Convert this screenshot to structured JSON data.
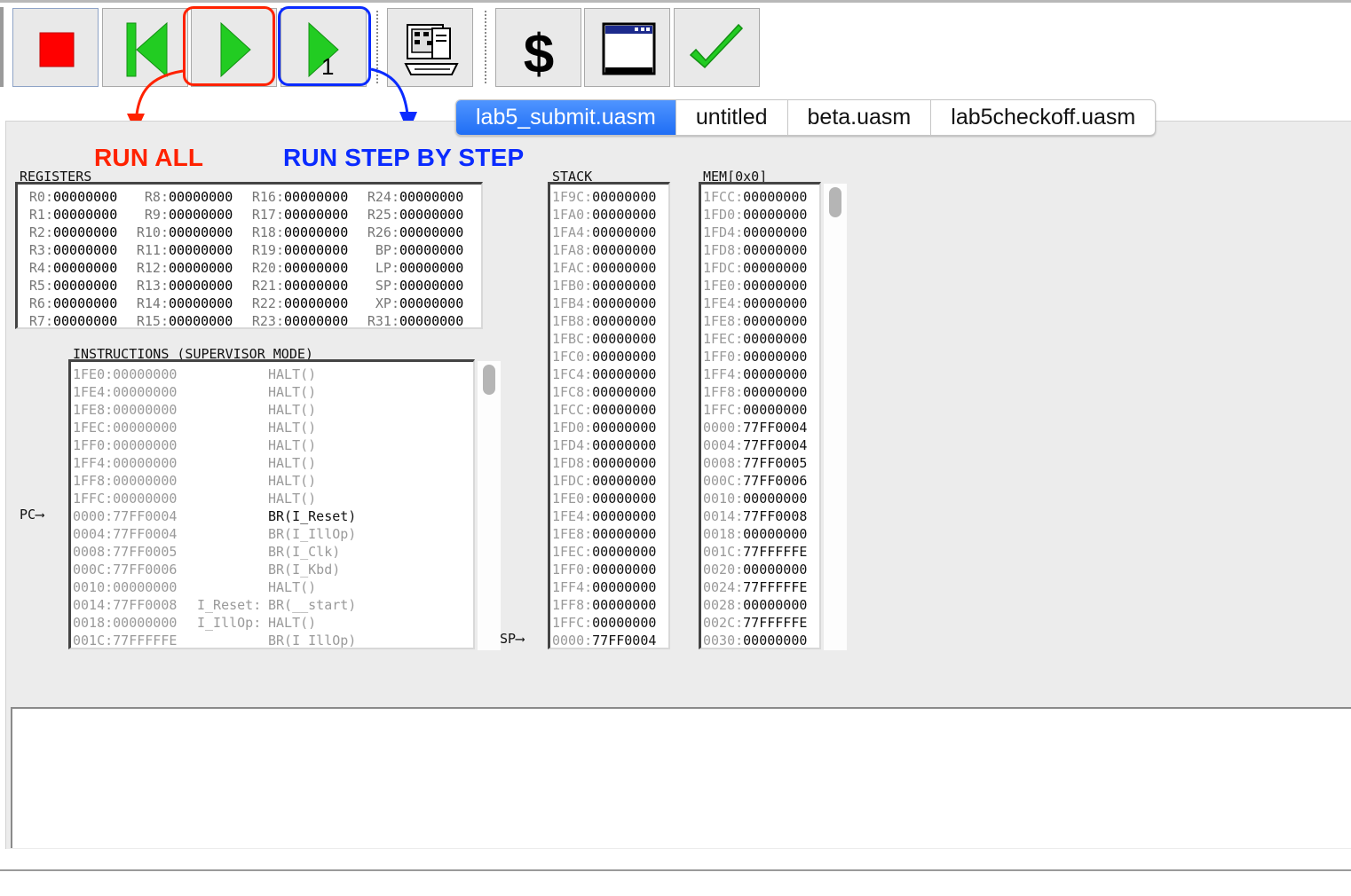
{
  "toolbar": {
    "buttons": [
      {
        "name": "stop-button",
        "icon": "stop-square-icon"
      },
      {
        "name": "reset-button",
        "icon": "skip-back-icon"
      },
      {
        "name": "run-button",
        "icon": "play-icon"
      },
      {
        "name": "step-button",
        "icon": "step-play-icon",
        "label": "1"
      },
      {
        "name": "assemble-button",
        "icon": "computer-icon"
      },
      {
        "name": "dollar-button",
        "icon": "dollar-icon"
      },
      {
        "name": "window-button",
        "icon": "window-icon"
      },
      {
        "name": "check-button",
        "icon": "checkmark-icon"
      }
    ],
    "step_count_label": "1"
  },
  "tabs": [
    {
      "label": "lab5_submit.uasm",
      "active": true
    },
    {
      "label": "untitled",
      "active": false
    },
    {
      "label": "beta.uasm",
      "active": false
    },
    {
      "label": "lab5checkoff.uasm",
      "active": false
    }
  ],
  "annotations": {
    "run_all": {
      "label": "RUN ALL",
      "color": "#ff2200"
    },
    "run_step": {
      "label": "RUN STEP BY STEP",
      "color": "#0a2bff"
    }
  },
  "registers": {
    "title": "REGISTERS",
    "rows": [
      [
        {
          "n": "R0:",
          "v": "00000000"
        },
        {
          "n": "R8:",
          "v": "00000000"
        },
        {
          "n": "R16:",
          "v": "00000000"
        },
        {
          "n": "R24:",
          "v": "00000000"
        }
      ],
      [
        {
          "n": "R1:",
          "v": "00000000"
        },
        {
          "n": "R9:",
          "v": "00000000"
        },
        {
          "n": "R17:",
          "v": "00000000"
        },
        {
          "n": "R25:",
          "v": "00000000"
        }
      ],
      [
        {
          "n": "R2:",
          "v": "00000000"
        },
        {
          "n": "R10:",
          "v": "00000000"
        },
        {
          "n": "R18:",
          "v": "00000000"
        },
        {
          "n": "R26:",
          "v": "00000000"
        }
      ],
      [
        {
          "n": "R3:",
          "v": "00000000"
        },
        {
          "n": "R11:",
          "v": "00000000"
        },
        {
          "n": "R19:",
          "v": "00000000"
        },
        {
          "n": "BP:",
          "v": "00000000"
        }
      ],
      [
        {
          "n": "R4:",
          "v": "00000000"
        },
        {
          "n": "R12:",
          "v": "00000000"
        },
        {
          "n": "R20:",
          "v": "00000000"
        },
        {
          "n": "LP:",
          "v": "00000000"
        }
      ],
      [
        {
          "n": "R5:",
          "v": "00000000"
        },
        {
          "n": "R13:",
          "v": "00000000"
        },
        {
          "n": "R21:",
          "v": "00000000"
        },
        {
          "n": "SP:",
          "v": "00000000"
        }
      ],
      [
        {
          "n": "R6:",
          "v": "00000000"
        },
        {
          "n": "R14:",
          "v": "00000000"
        },
        {
          "n": "R22:",
          "v": "00000000"
        },
        {
          "n": "XP:",
          "v": "00000000"
        }
      ],
      [
        {
          "n": "R7:",
          "v": "00000000"
        },
        {
          "n": "R15:",
          "v": "00000000"
        },
        {
          "n": "R23:",
          "v": "00000000"
        },
        {
          "n": "R31:",
          "v": "00000000"
        }
      ]
    ]
  },
  "instructions": {
    "title": "INSTRUCTIONS (SUPERVISOR MODE)",
    "pc_label": "PC",
    "rows": [
      {
        "addr": "1FE0:00000000",
        "label": "",
        "op": "HALT()",
        "current": false
      },
      {
        "addr": "1FE4:00000000",
        "label": "",
        "op": "HALT()",
        "current": false
      },
      {
        "addr": "1FE8:00000000",
        "label": "",
        "op": "HALT()",
        "current": false
      },
      {
        "addr": "1FEC:00000000",
        "label": "",
        "op": "HALT()",
        "current": false
      },
      {
        "addr": "1FF0:00000000",
        "label": "",
        "op": "HALT()",
        "current": false
      },
      {
        "addr": "1FF4:00000000",
        "label": "",
        "op": "HALT()",
        "current": false
      },
      {
        "addr": "1FF8:00000000",
        "label": "",
        "op": "HALT()",
        "current": false
      },
      {
        "addr": "1FFC:00000000",
        "label": "",
        "op": "HALT()",
        "current": false
      },
      {
        "addr": "0000:77FF0004",
        "label": "",
        "op": "BR(I_Reset)",
        "current": true
      },
      {
        "addr": "0004:77FF0004",
        "label": "",
        "op": "BR(I_IllOp)",
        "current": false
      },
      {
        "addr": "0008:77FF0005",
        "label": "",
        "op": "BR(I_Clk)",
        "current": false
      },
      {
        "addr": "000C:77FF0006",
        "label": "",
        "op": "BR(I_Kbd)",
        "current": false
      },
      {
        "addr": "0010:00000000",
        "label": "",
        "op": "HALT()",
        "current": false
      },
      {
        "addr": "0014:77FF0008",
        "label": "I_Reset:",
        "op": "BR(__start)",
        "current": false
      },
      {
        "addr": "0018:00000000",
        "label": "I_IllOp:",
        "op": "HALT()",
        "current": false
      },
      {
        "addr": "001C:77FFFFFE",
        "label": "",
        "op": "BR(I_IllOp)",
        "current": false
      }
    ]
  },
  "stack": {
    "title": "STACK",
    "sp_label": "SP",
    "rows": [
      {
        "a": "1F9C:",
        "v": "00000000"
      },
      {
        "a": "1FA0:",
        "v": "00000000"
      },
      {
        "a": "1FA4:",
        "v": "00000000"
      },
      {
        "a": "1FA8:",
        "v": "00000000"
      },
      {
        "a": "1FAC:",
        "v": "00000000"
      },
      {
        "a": "1FB0:",
        "v": "00000000"
      },
      {
        "a": "1FB4:",
        "v": "00000000"
      },
      {
        "a": "1FB8:",
        "v": "00000000"
      },
      {
        "a": "1FBC:",
        "v": "00000000"
      },
      {
        "a": "1FC0:",
        "v": "00000000"
      },
      {
        "a": "1FC4:",
        "v": "00000000"
      },
      {
        "a": "1FC8:",
        "v": "00000000"
      },
      {
        "a": "1FCC:",
        "v": "00000000"
      },
      {
        "a": "1FD0:",
        "v": "00000000"
      },
      {
        "a": "1FD4:",
        "v": "00000000"
      },
      {
        "a": "1FD8:",
        "v": "00000000"
      },
      {
        "a": "1FDC:",
        "v": "00000000"
      },
      {
        "a": "1FE0:",
        "v": "00000000"
      },
      {
        "a": "1FE4:",
        "v": "00000000"
      },
      {
        "a": "1FE8:",
        "v": "00000000"
      },
      {
        "a": "1FEC:",
        "v": "00000000"
      },
      {
        "a": "1FF0:",
        "v": "00000000"
      },
      {
        "a": "1FF4:",
        "v": "00000000"
      },
      {
        "a": "1FF8:",
        "v": "00000000"
      },
      {
        "a": "1FFC:",
        "v": "00000000"
      },
      {
        "a": "0000:",
        "v": "77FF0004"
      }
    ]
  },
  "memory": {
    "title": "MEM[0x0]",
    "rows": [
      {
        "a": "1FCC:",
        "v": "00000000"
      },
      {
        "a": "1FD0:",
        "v": "00000000"
      },
      {
        "a": "1FD4:",
        "v": "00000000"
      },
      {
        "a": "1FD8:",
        "v": "00000000"
      },
      {
        "a": "1FDC:",
        "v": "00000000"
      },
      {
        "a": "1FE0:",
        "v": "00000000"
      },
      {
        "a": "1FE4:",
        "v": "00000000"
      },
      {
        "a": "1FE8:",
        "v": "00000000"
      },
      {
        "a": "1FEC:",
        "v": "00000000"
      },
      {
        "a": "1FF0:",
        "v": "00000000"
      },
      {
        "a": "1FF4:",
        "v": "00000000"
      },
      {
        "a": "1FF8:",
        "v": "00000000"
      },
      {
        "a": "1FFC:",
        "v": "00000000"
      },
      {
        "a": "0000:",
        "v": "77FF0004"
      },
      {
        "a": "0004:",
        "v": "77FF0004"
      },
      {
        "a": "0008:",
        "v": "77FF0005"
      },
      {
        "a": "000C:",
        "v": "77FF0006"
      },
      {
        "a": "0010:",
        "v": "00000000"
      },
      {
        "a": "0014:",
        "v": "77FF0008"
      },
      {
        "a": "0018:",
        "v": "00000000"
      },
      {
        "a": "001C:",
        "v": "77FFFFFE"
      },
      {
        "a": "0020:",
        "v": "00000000"
      },
      {
        "a": "0024:",
        "v": "77FFFFFE"
      },
      {
        "a": "0028:",
        "v": "00000000"
      },
      {
        "a": "002C:",
        "v": "77FFFFFE"
      },
      {
        "a": "0030:",
        "v": "00000000"
      }
    ]
  },
  "console": {
    "text": ""
  }
}
